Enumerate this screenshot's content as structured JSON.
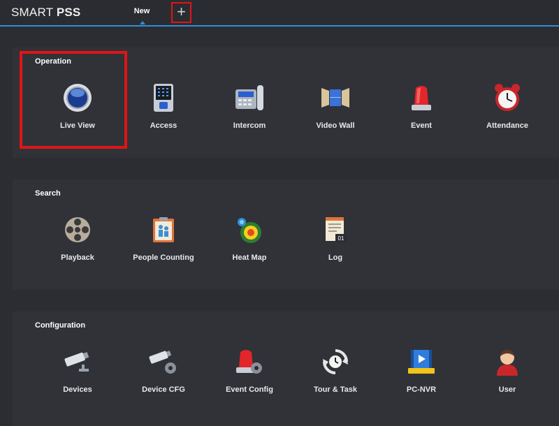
{
  "app": {
    "logo_prefix": "SMART ",
    "logo_suffix": "PSS"
  },
  "tabs": {
    "new_label": "New",
    "add_symbol": "+"
  },
  "sections": {
    "operation": {
      "title": "Operation",
      "items": [
        {
          "label": "Live View",
          "icon": "live-view-icon"
        },
        {
          "label": "Access",
          "icon": "access-icon"
        },
        {
          "label": "Intercom",
          "icon": "intercom-icon"
        },
        {
          "label": "Video Wall",
          "icon": "video-wall-icon"
        },
        {
          "label": "Event",
          "icon": "event-icon"
        },
        {
          "label": "Attendance",
          "icon": "attendance-icon"
        }
      ]
    },
    "search": {
      "title": "Search",
      "items": [
        {
          "label": "Playback",
          "icon": "playback-icon"
        },
        {
          "label": "People Counting",
          "icon": "people-counting-icon"
        },
        {
          "label": "Heat Map",
          "icon": "heat-map-icon"
        },
        {
          "label": "Log",
          "icon": "log-icon"
        }
      ]
    },
    "configuration": {
      "title": "Configuration",
      "items": [
        {
          "label": "Devices",
          "icon": "devices-icon"
        },
        {
          "label": "Device CFG",
          "icon": "device-cfg-icon"
        },
        {
          "label": "Event Config",
          "icon": "event-config-icon"
        },
        {
          "label": "Tour & Task",
          "icon": "tour-task-icon"
        },
        {
          "label": "PC-NVR",
          "icon": "pc-nvr-icon"
        },
        {
          "label": "User",
          "icon": "user-icon"
        }
      ]
    }
  },
  "colors": {
    "background": "#2b2d33",
    "section": "#303238",
    "accent": "#2f8fd6",
    "highlight": "#e01515"
  }
}
